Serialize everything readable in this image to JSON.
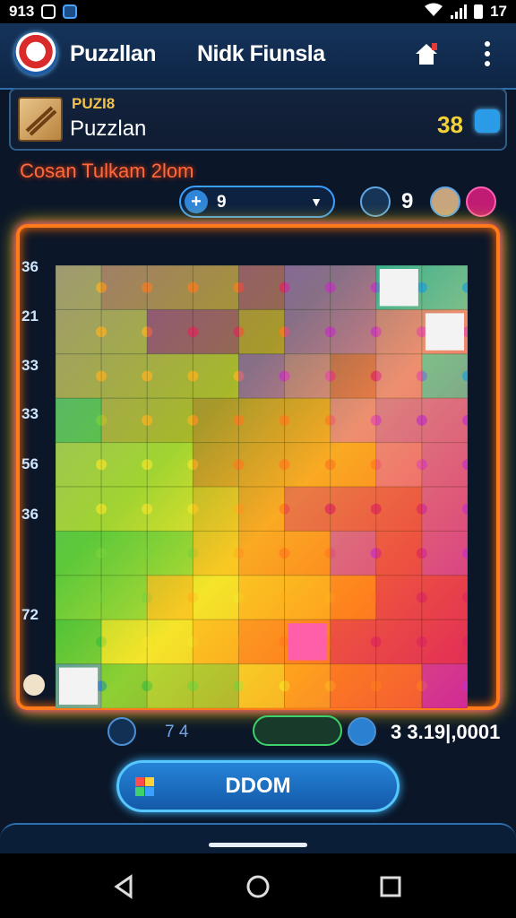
{
  "status_bar": {
    "left_text": "913",
    "right_text": "17"
  },
  "header": {
    "app_title": "Puzzllan",
    "player_title": "Nidk Fiunsla"
  },
  "card": {
    "tag": "PUZI8",
    "name": "Puzzlan",
    "score": "38"
  },
  "subtitle": "Cosan Tulkam 2lom",
  "search": {
    "value": "9"
  },
  "players": {
    "count": "9"
  },
  "row_labels": [
    "36",
    "21",
    "33",
    "33",
    "56",
    "36",
    "72"
  ],
  "bottom_bar": {
    "count": "7 4",
    "score": "3 3.19|,0001"
  },
  "main_button": {
    "label": "DDOM"
  },
  "icons": {
    "home": "home-icon",
    "menu": "kebab-menu-icon",
    "search": "search-icon",
    "players": "players-icon",
    "avatar": "avatar-icon",
    "target": "target-icon",
    "layers": "layers-icon",
    "share": "share-icon",
    "back": "back-icon",
    "nav_home": "circle-home-icon",
    "recents": "square-recents-icon"
  },
  "colors": {
    "frame_glow": "#ff7a1a",
    "accent": "#2a9be6",
    "score_gold": "#f6d23a",
    "subtitle": "#ff6a3d"
  }
}
